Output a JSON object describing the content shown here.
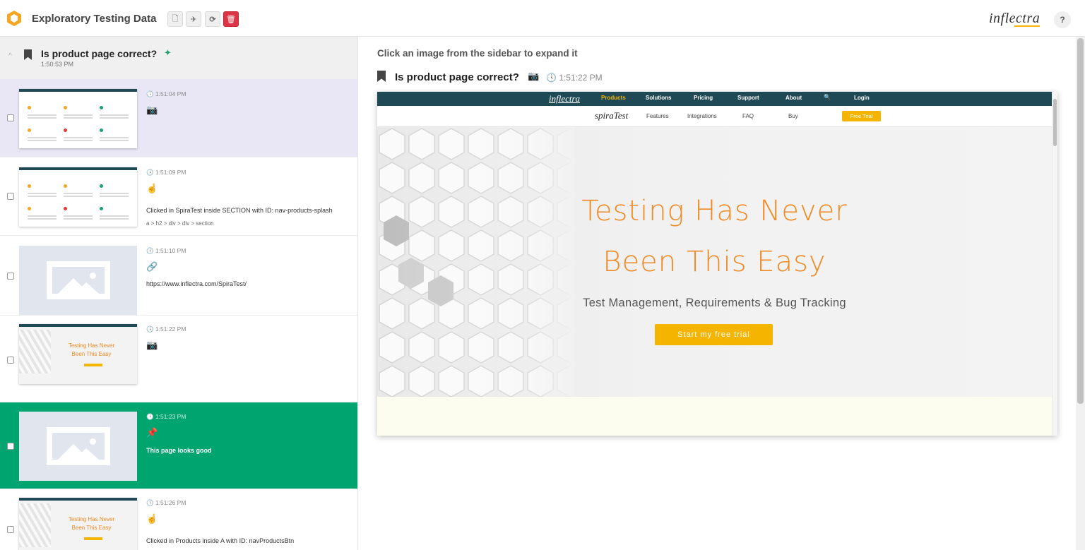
{
  "header": {
    "app_title": "Exploratory Testing Data",
    "brand": "inflectra",
    "help_label": "?",
    "toolbar": [
      {
        "name": "new-document-icon",
        "glyph": "🗋"
      },
      {
        "name": "send-icon",
        "glyph": "✈"
      },
      {
        "name": "refresh-icon",
        "glyph": "⟳"
      },
      {
        "name": "trash-icon",
        "glyph": "🗑"
      }
    ]
  },
  "sidebar": {
    "session": {
      "title": "Is product page correct?",
      "time": "1:50:53 PM",
      "chevron": "^",
      "pin": "✦"
    },
    "items": [
      {
        "time": "🕓 1:51:04 PM",
        "icon": "📷",
        "text": "",
        "sub": ""
      },
      {
        "time": "🕓 1:51:09 PM",
        "icon": "☝",
        "text": "Clicked in SpiraTest inside SECTION with ID: nav-products-splash",
        "sub": "a > h2 > div > div > section"
      },
      {
        "time": "🕓 1:51:10 PM",
        "icon": "🔗",
        "text": "https://www.inflectra.com/SpiraTest/",
        "sub": ""
      },
      {
        "time": "🕓 1:51:22 PM",
        "icon": "📷",
        "text": "",
        "sub": ""
      },
      {
        "time": "🕓 1:51:23 PM",
        "icon": "📌",
        "text": "This page looks good",
        "sub": ""
      },
      {
        "time": "🕓 1:51:26 PM",
        "icon": "☝",
        "text": "Clicked in Products inside A with ID: navProductsBtn",
        "sub": ""
      }
    ],
    "thumb_hero": {
      "line1": "Testing Has Never",
      "line2": "Been This Easy"
    }
  },
  "main": {
    "hint": "Click an image from the sidebar to expand it",
    "event": {
      "title": "Is product page correct?",
      "camera": "📷",
      "time": "🕓 1:51:22 PM"
    },
    "screenshot": {
      "nav_brand": "inflectra",
      "nav_items": [
        "Products",
        "Solutions",
        "Pricing",
        "Support",
        "About",
        "Login"
      ],
      "search_glyph": "🔍",
      "sub_brand": "spiraTest",
      "sub_items": [
        "Features",
        "Integrations",
        "FAQ",
        "Buy"
      ],
      "free_trial": "Free Trial",
      "hero_line1": "Testing Has Never",
      "hero_line2": "Been This Easy",
      "hero_sub": "Test Management, Requirements & Bug Tracking",
      "hero_button": "Start my free trial"
    }
  },
  "colors": {
    "accent_green": "#00a46f",
    "selected_purple": "#e9e6f5",
    "delete_red": "#dc3545",
    "nav_teal": "#1f4a55",
    "hero_orange": "#f08a24",
    "cta_yellow": "#f5b400"
  }
}
